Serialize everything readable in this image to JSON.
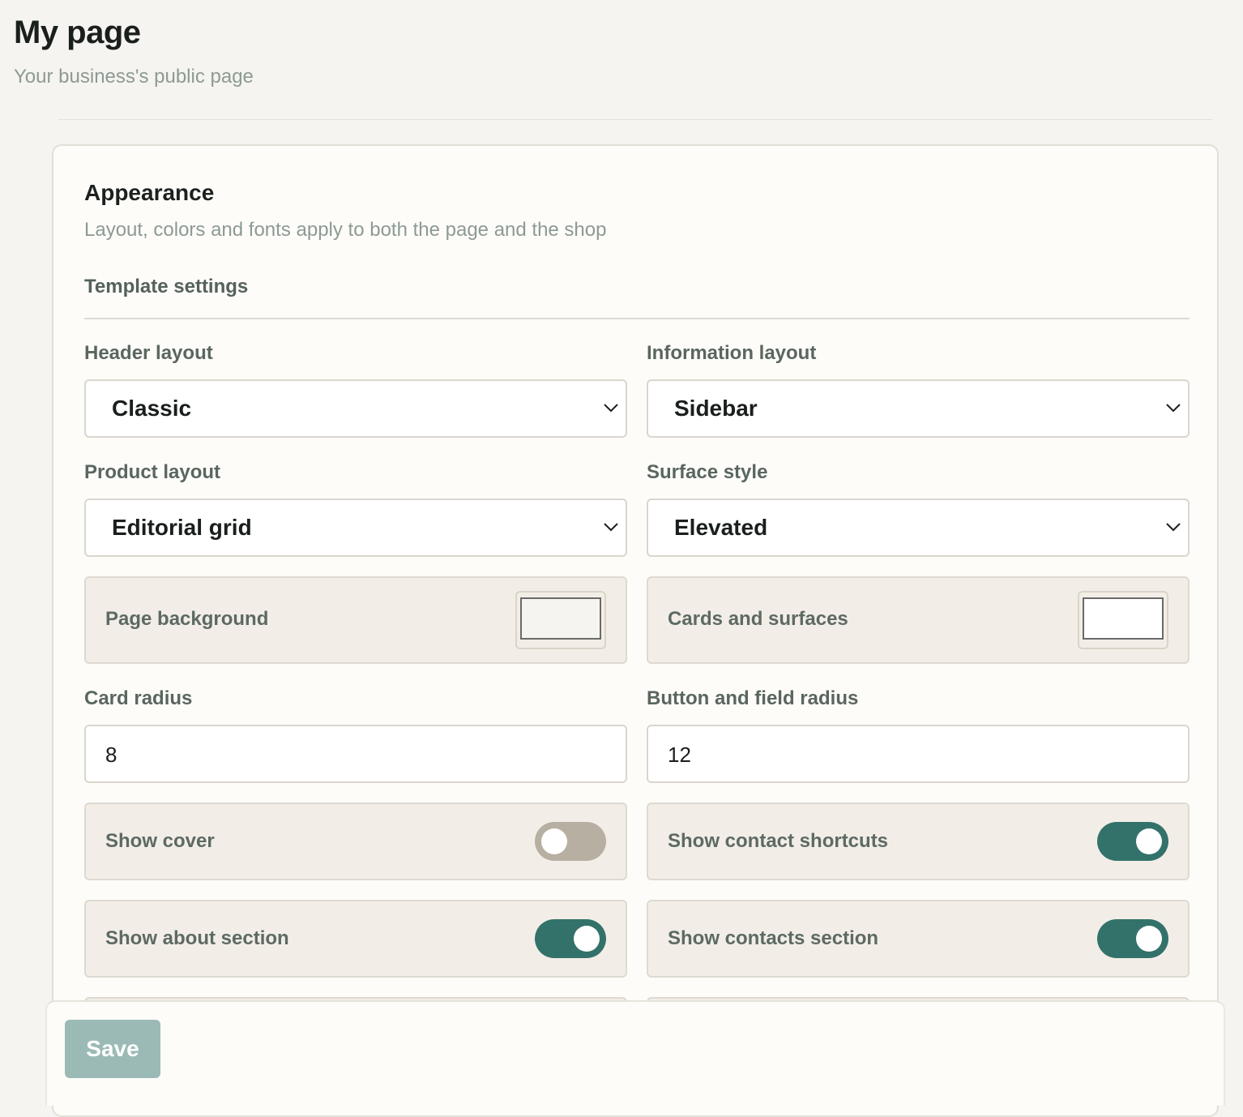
{
  "page": {
    "title": "My page",
    "subtitle": "Your business's public page"
  },
  "appearance": {
    "title": "Appearance",
    "description": "Layout, colors and fonts apply to both the page and the shop",
    "group_title": "Template settings",
    "header_layout": {
      "label": "Header layout",
      "value": "Classic"
    },
    "information_layout": {
      "label": "Information layout",
      "value": "Sidebar"
    },
    "product_layout": {
      "label": "Product layout",
      "value": "Editorial grid"
    },
    "surface_style": {
      "label": "Surface style",
      "value": "Elevated"
    },
    "page_background": {
      "label": "Page background",
      "color": "#f5f4f0"
    },
    "cards_and_surfaces": {
      "label": "Cards and surfaces",
      "color": "#ffffff"
    },
    "card_radius": {
      "label": "Card radius",
      "value": "8"
    },
    "button_field_radius": {
      "label": "Button and field radius",
      "value": "12"
    },
    "toggles": {
      "show_cover": {
        "label": "Show cover",
        "on": false
      },
      "show_contact_shortcuts": {
        "label": "Show contact shortcuts",
        "on": true
      },
      "show_about_section": {
        "label": "Show about section",
        "on": true
      },
      "show_contacts_section": {
        "label": "Show contacts section",
        "on": true
      }
    }
  },
  "footer": {
    "save_label": "Save"
  },
  "colors": {
    "accent": "#33726a",
    "toggle_off": "#b7afa2",
    "save_disabled": "#9cbab5"
  }
}
